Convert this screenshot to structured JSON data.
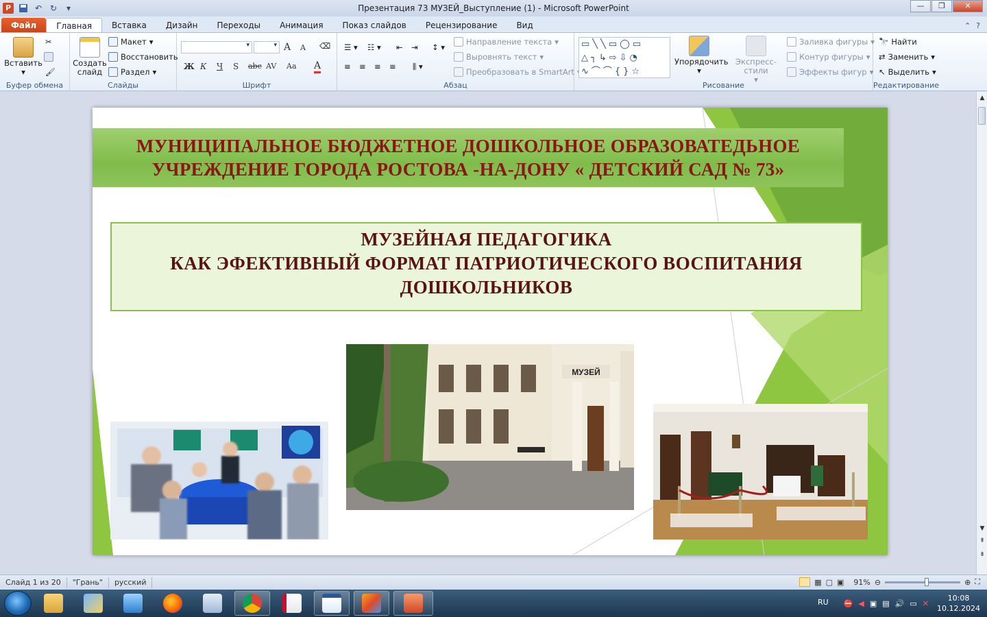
{
  "window": {
    "title": "Презентация  73  МУЗЕЙ_Выступление (1)  -  Microsoft PowerPoint",
    "app_icon": "P",
    "buttons": [
      "—",
      "❐",
      "✕"
    ]
  },
  "tabs": [
    {
      "label": "Файл"
    },
    {
      "label": "Главная"
    },
    {
      "label": "Вставка"
    },
    {
      "label": "Дизайн"
    },
    {
      "label": "Переходы"
    },
    {
      "label": "Анимация"
    },
    {
      "label": "Показ слайдов"
    },
    {
      "label": "Рецензирование"
    },
    {
      "label": "Вид"
    }
  ],
  "ribbon": {
    "clipboard": {
      "label": "Буфер обмена",
      "paste": "Вставить"
    },
    "slides": {
      "label": "Слайды",
      "new_slide": "Создать слайд",
      "layout": "Макет",
      "reset": "Восстановить",
      "section": "Раздел"
    },
    "font": {
      "label": "Шрифт",
      "bold": "Ж",
      "italic": "К",
      "underline": "Ч",
      "shadow": "S",
      "strike": "abc",
      "spacing": "AV",
      "case": "Aa",
      "grow": "A",
      "shrink": "A",
      "color": "A"
    },
    "paragraph": {
      "label": "Абзац",
      "direction": "Направление текста",
      "align": "Выровнять текст",
      "smartart": "Преобразовать в SmartArt"
    },
    "drawing": {
      "label": "Рисование",
      "arrange": "Упорядочить",
      "styles": "Экспресс-стили",
      "fill": "Заливка фигуры",
      "outline": "Контур фигуры",
      "effects": "Эффекты фигур"
    },
    "editing": {
      "label": "Редактирование",
      "find": "Найти",
      "replace": "Заменить",
      "select": "Выделить"
    }
  },
  "slide": {
    "header_line1": "МУНИЦИПАЛЬНОЕ  БЮДЖЕТНОЕ ДОШКОЛЬНОЕ  ОБРАЗОВАТЕДЬНОЕ",
    "header_line2": "УЧРЕЖДЕНИЕ ГОРОДА РОСТОВА -НА-ДОНУ « ДЕТСКИЙ САД № 73»",
    "title_line1": "МУЗЕЙНАЯ  ПЕДАГОГИКА",
    "title_line2": "КАК  ЭФЕКТИВНЫЙ  ФОРМАТ  ПАТРИОТИЧЕСКОГО  ВОСПИТАНИЯ",
    "title_line3": "ДОШКОЛЬНИКОВ",
    "museum_sign": "МУЗЕЙ",
    "colors": {
      "header_text": "#8b1616",
      "title_text": "#5a1313",
      "accent_green": "#8bc34a"
    }
  },
  "status": {
    "slide": "Слайд 1 из 20",
    "theme": "\"Грань\"",
    "lang": "русский",
    "zoom": "91%",
    "zoom_level": 0.55
  },
  "taskbar": {
    "lang": "RU",
    "time": "10:08",
    "date": "10.12.2024"
  }
}
